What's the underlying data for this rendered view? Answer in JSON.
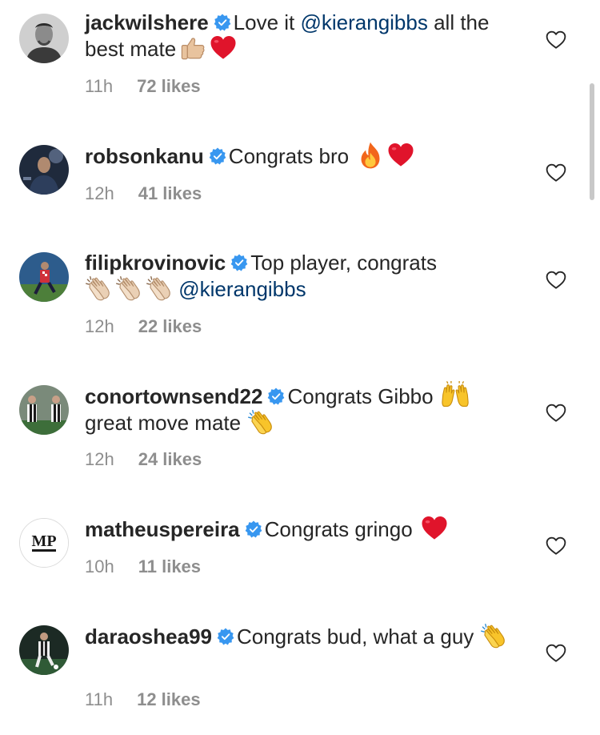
{
  "comments": [
    {
      "username": "jackwilshere",
      "verified": true,
      "text_before": "Love it ",
      "mention": "@kierangibbs",
      "text_after": " all the best mate",
      "emojis": [
        "thumbs-up",
        "red-heart"
      ],
      "time": "11h",
      "likes": "72 likes"
    },
    {
      "username": "robsonkanu",
      "verified": true,
      "text_before": "Congrats bro",
      "mention": "",
      "text_after": "",
      "emojis": [
        "fire",
        "red-heart"
      ],
      "time": "12h",
      "likes": "41 likes"
    },
    {
      "username": "filipkrovinovic",
      "verified": true,
      "text_before": "Top player, congrats",
      "mention": "@kierangibbs",
      "text_after": "",
      "emojis": [
        "clapping-hands",
        "clapping-hands",
        "clapping-hands"
      ],
      "time": "12h",
      "likes": "22 likes"
    },
    {
      "username": "conortownsend22",
      "verified": true,
      "text_before": "Congrats Gibbo",
      "mention": "",
      "text_after": "great move mate",
      "emojis": [
        "raising-hands",
        "clapping-hands-yellow"
      ],
      "time": "12h",
      "likes": "24 likes"
    },
    {
      "username": "matheuspereira",
      "verified": true,
      "text_before": "Congrats gringo",
      "mention": "",
      "text_after": "",
      "emojis": [
        "red-heart"
      ],
      "time": "10h",
      "likes": "11 likes"
    },
    {
      "username": "daraoshea99",
      "verified": true,
      "text_before": "Congrats bud, what a guy",
      "mention": "",
      "text_after": "",
      "emojis": [
        "clapping-hands-yellow"
      ],
      "time": "11h",
      "likes": "12 likes"
    }
  ],
  "avatar_logo_text": "MP",
  "colors": {
    "text": "#262626",
    "secondary": "#8e8e8e",
    "mention": "#00376b",
    "verified": "#3897f0"
  },
  "icons": {
    "verified": "verified-badge-icon",
    "like": "heart-outline-icon"
  }
}
